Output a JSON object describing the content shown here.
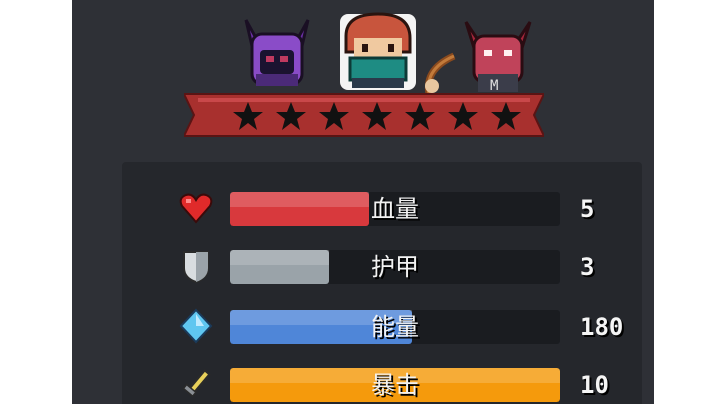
{
  "characters": [
    {
      "name": "purple-horned-demon",
      "color": "#7a3fb5"
    },
    {
      "name": "red-haired-rogue",
      "color": "#c8553d"
    },
    {
      "name": "red-horned-demon",
      "color": "#b83a4c"
    }
  ],
  "rating": {
    "stars": 7,
    "ribbon_color": "#a8302e"
  },
  "stats": [
    {
      "key": "hp",
      "label": "血量",
      "value": "5",
      "fill": 0.42,
      "color": "#d8393d",
      "icon": "heart-icon"
    },
    {
      "key": "armor",
      "label": "护甲",
      "value": "3",
      "fill": 0.3,
      "color": "#9aa3a9",
      "icon": "shield-icon"
    },
    {
      "key": "energy",
      "label": "能量",
      "value": "180",
      "fill": 0.55,
      "color": "#4f86d8",
      "icon": "diamond-icon"
    },
    {
      "key": "crit",
      "label": "暴击",
      "value": "10",
      "fill": 1.0,
      "color": "#f59a0c",
      "icon": "sword-icon"
    }
  ]
}
